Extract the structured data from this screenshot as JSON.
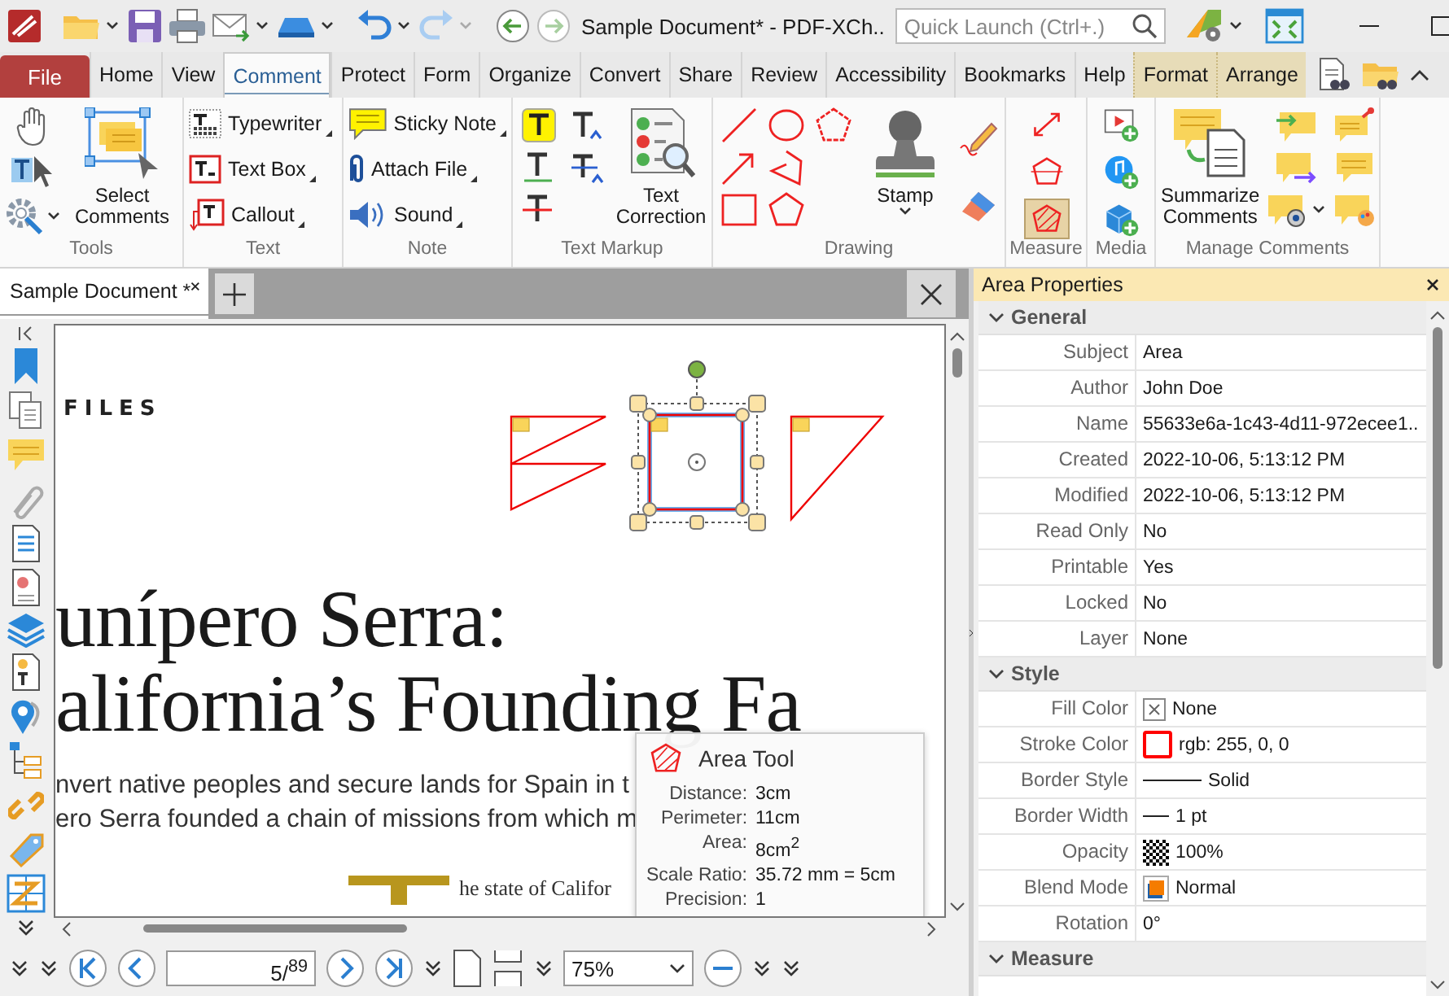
{
  "window": {
    "title": "Sample Document* - PDF-XCh..",
    "quick_launch": {
      "placeholder": "Quick Launch (Ctrl+.)"
    }
  },
  "menu_tabs": [
    {
      "label": "File",
      "kind": "file",
      "selected": false
    },
    {
      "label": "Home",
      "kind": "tab",
      "selected": false
    },
    {
      "label": "View",
      "kind": "tab",
      "selected": false
    },
    {
      "label": "Comment",
      "kind": "tab",
      "selected": true
    },
    {
      "label": "Protect",
      "kind": "tab",
      "selected": false
    },
    {
      "label": "Form",
      "kind": "tab",
      "selected": false
    },
    {
      "label": "Organize",
      "kind": "tab",
      "selected": false
    },
    {
      "label": "Convert",
      "kind": "tab",
      "selected": false
    },
    {
      "label": "Share",
      "kind": "tab",
      "selected": false
    },
    {
      "label": "Review",
      "kind": "tab",
      "selected": false
    },
    {
      "label": "Accessibility",
      "kind": "tab",
      "selected": false
    },
    {
      "label": "Bookmarks",
      "kind": "tab",
      "selected": false
    },
    {
      "label": "Help",
      "kind": "tab",
      "selected": false
    },
    {
      "label": "Format",
      "kind": "context",
      "selected": false
    },
    {
      "label": "Arrange",
      "kind": "context",
      "selected": false
    }
  ],
  "ribbon": {
    "tools": {
      "label": "Tools",
      "select_comments": "Select Comments"
    },
    "text": {
      "label": "Text",
      "buttons": [
        "Typewriter",
        "Text Box",
        "Callout"
      ]
    },
    "note": {
      "label": "Note",
      "buttons": [
        "Sticky Note",
        "Attach File",
        "Sound"
      ]
    },
    "text_markup": {
      "label": "Text Markup",
      "text_correction": "Text Correction"
    },
    "drawing": {
      "label": "Drawing",
      "stamp": "Stamp"
    },
    "measure": {
      "label": "Measure",
      "tools": [
        {
          "selected": false
        },
        {
          "selected": false
        },
        {
          "selected": true
        }
      ]
    },
    "media": {
      "label": "Media"
    },
    "manage_comments": {
      "label": "Manage Comments",
      "summarize": "Summarize Comments"
    }
  },
  "document": {
    "tabs": [
      {
        "label": "Sample Document *",
        "selected": true
      }
    ],
    "page": {
      "section_label": "FILES",
      "title_lines": [
        "unípero Serra:",
        "alifornia’s Founding Fa"
      ],
      "body_lines": [
        "nvert native peoples and secure lands for Spain in t",
        "ero Serra founded a chain of missions from which m"
      ],
      "drop_cap_line": "he state of Califor"
    },
    "tooltip": {
      "title": "Area Tool",
      "rows": [
        {
          "label": "Distance:",
          "value": "3cm"
        },
        {
          "label": "Perimeter:",
          "value": "11cm"
        },
        {
          "label": "Area:",
          "value": "8cm$^{2}$"
        },
        {
          "label": "Scale Ratio:",
          "value": "35.72 mm = 5cm"
        },
        {
          "label": "Precision:",
          "value": "1"
        }
      ]
    },
    "navigation": {
      "page_field": "5/$^{89}$",
      "zoom": "75%"
    }
  },
  "properties": {
    "title": "Area Properties",
    "sections": [
      {
        "title": "General",
        "expanded": true,
        "rows": [
          {
            "label": "Subject",
            "value": "Area",
            "kind": "text"
          },
          {
            "label": "Author",
            "value": "John Doe",
            "kind": "text"
          },
          {
            "label": "Name",
            "value": "55633e6a-1c43-4d11-972ecee1..",
            "kind": "text"
          },
          {
            "label": "Created",
            "value": "2022-10-06, 5:13:12 PM",
            "kind": "text"
          },
          {
            "label": "Modified",
            "value": "2022-10-06, 5:13:12 PM",
            "kind": "text"
          },
          {
            "label": "Read Only",
            "value": "No",
            "kind": "text"
          },
          {
            "label": "Printable",
            "value": "Yes",
            "kind": "text"
          },
          {
            "label": "Locked",
            "value": "No",
            "kind": "text"
          },
          {
            "label": "Layer",
            "value": "None",
            "kind": "text"
          }
        ]
      },
      {
        "title": "Style",
        "expanded": true,
        "rows": [
          {
            "label": "Fill Color",
            "value": "None",
            "kind": "no_color"
          },
          {
            "label": "Stroke Color",
            "value": "rgb: 255, 0, 0",
            "kind": "color",
            "color": "#ff0000"
          },
          {
            "label": "Border Style",
            "value": "Solid",
            "kind": "line"
          },
          {
            "label": "Border Width",
            "value": "1 pt",
            "kind": "short_line"
          },
          {
            "label": "Opacity",
            "value": "100%",
            "kind": "pattern"
          },
          {
            "label": "Blend Mode",
            "value": "Normal",
            "kind": "blend"
          },
          {
            "label": "Rotation",
            "value": "0°",
            "kind": "text"
          }
        ]
      },
      {
        "title": "Measure",
        "expanded": true
      }
    ]
  }
}
